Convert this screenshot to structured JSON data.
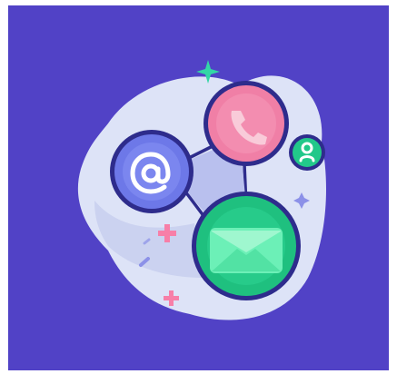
{
  "illustration": {
    "subject": "contact-communication-icons",
    "icons": [
      "at-sign-icon",
      "phone-icon",
      "contact-user-icon",
      "envelope-icon"
    ],
    "decorations": [
      "sparkle-icon",
      "plus-icon"
    ],
    "colors": {
      "background": "#5142C6",
      "blob": "#DDE3F7",
      "blob_shadow": "#C3CBEC",
      "outline": "#2E2C8C",
      "at_circle": "#6D78E8",
      "phone_circle": "#F07FA6",
      "phone_glyph": "#F9CBD9",
      "contact_circle": "#22C88A",
      "mail_circle": "#1FC07F",
      "mail_envelope": "#6CF0B7",
      "sparkle_teal": "#33D6A6",
      "sparkle_pink": "#F77FA8",
      "sparkle_lavender": "#8C91E8"
    }
  }
}
